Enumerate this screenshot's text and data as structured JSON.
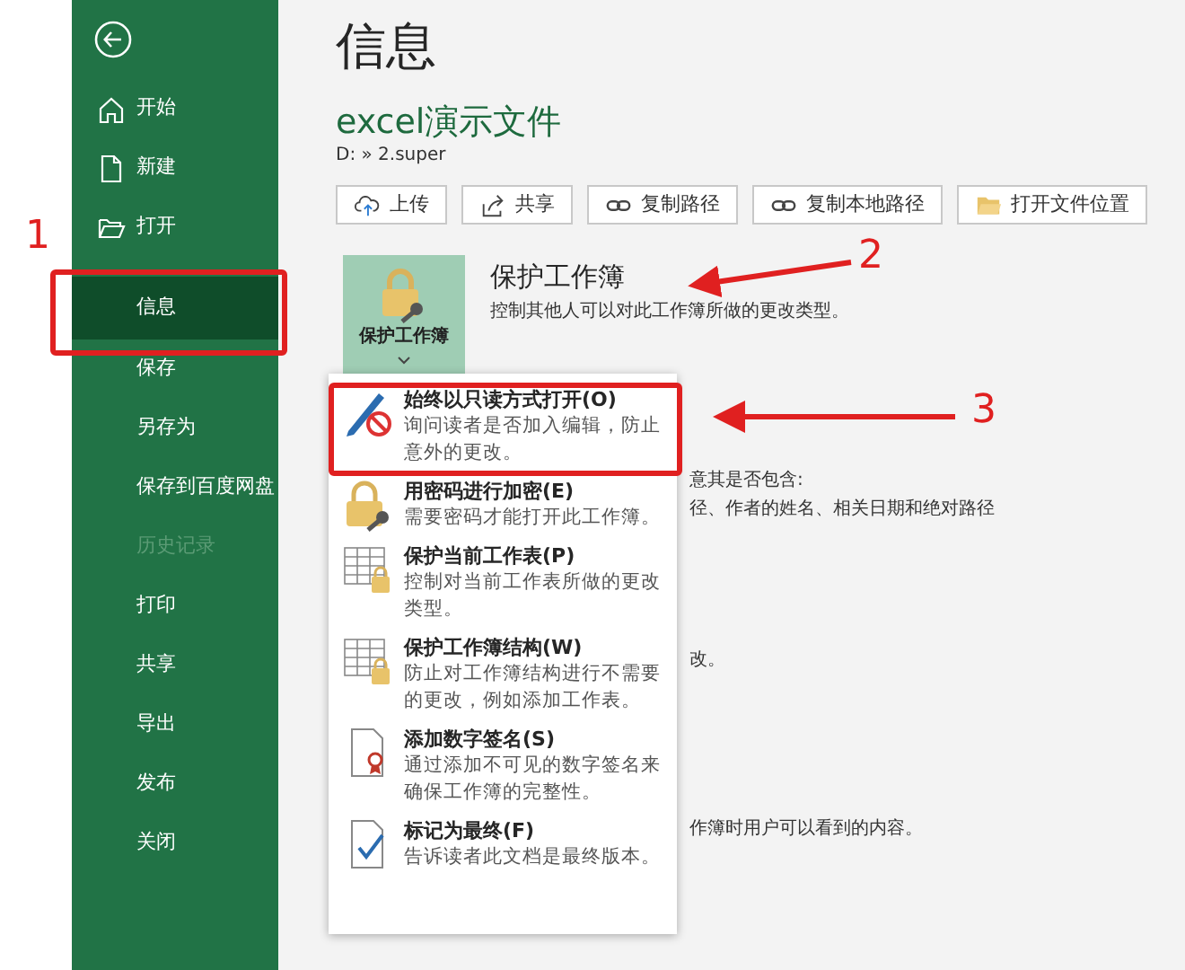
{
  "sidebar": {
    "items": [
      {
        "label": "开始",
        "kind": "home",
        "selected": false,
        "disabled": false
      },
      {
        "label": "新建",
        "kind": "new",
        "selected": false,
        "disabled": false
      },
      {
        "label": "打开",
        "kind": "open",
        "selected": false,
        "disabled": false
      },
      {
        "label": "信息",
        "kind": "plain",
        "selected": true,
        "disabled": false
      },
      {
        "label": "保存",
        "kind": "plain",
        "selected": false,
        "disabled": false
      },
      {
        "label": "另存为",
        "kind": "plain",
        "selected": false,
        "disabled": false
      },
      {
        "label": "保存到百度网盘",
        "kind": "plain",
        "selected": false,
        "disabled": false
      },
      {
        "label": "历史记录",
        "kind": "plain",
        "selected": false,
        "disabled": true
      },
      {
        "label": "打印",
        "kind": "plain",
        "selected": false,
        "disabled": false
      },
      {
        "label": "共享",
        "kind": "plain",
        "selected": false,
        "disabled": false
      },
      {
        "label": "导出",
        "kind": "plain",
        "selected": false,
        "disabled": false
      },
      {
        "label": "发布",
        "kind": "plain",
        "selected": false,
        "disabled": false
      },
      {
        "label": "关闭",
        "kind": "plain",
        "selected": false,
        "disabled": false
      }
    ]
  },
  "page_title": "信息",
  "file": {
    "name": "excel演示文件",
    "path": "D: » 2.super"
  },
  "actions": [
    {
      "label": "上传",
      "kind": "upload"
    },
    {
      "label": "共享",
      "kind": "share"
    },
    {
      "label": "复制路径",
      "kind": "link"
    },
    {
      "label": "复制本地路径",
      "kind": "link"
    },
    {
      "label": "打开文件位置",
      "kind": "folder"
    }
  ],
  "protect": {
    "button_label": "保护工作簿",
    "title": "保护工作簿",
    "description": "控制其他人可以对此工作簿所做的更改类型。"
  },
  "menu": {
    "items": [
      {
        "title": "始终以只读方式打开(O)",
        "description": "询问读者是否加入编辑，防止意外的更改。",
        "kind": "readonly"
      },
      {
        "title": "用密码进行加密(E)",
        "description": "需要密码才能打开此工作簿。",
        "kind": "password"
      },
      {
        "title": "保护当前工作表(P)",
        "description": "控制对当前工作表所做的更改类型。",
        "kind": "sheet"
      },
      {
        "title": "保护工作簿结构(W)",
        "description": "防止对工作簿结构进行不需要的更改，例如添加工作表。",
        "kind": "structure"
      },
      {
        "title": "添加数字签名(S)",
        "description": "通过添加不可见的数字签名来确保工作簿的完整性。",
        "kind": "signature"
      },
      {
        "title": "标记为最终(F)",
        "description": "告诉读者此文档是最终版本。",
        "kind": "final"
      }
    ]
  },
  "background_texts": [
    "意其是否包含:",
    "径、作者的姓名、相关日期和绝对路径",
    "改。",
    "作簿时用户可以看到的内容。"
  ],
  "annotations": [
    {
      "label": "1"
    },
    {
      "label": "2"
    },
    {
      "label": "3"
    }
  ]
}
